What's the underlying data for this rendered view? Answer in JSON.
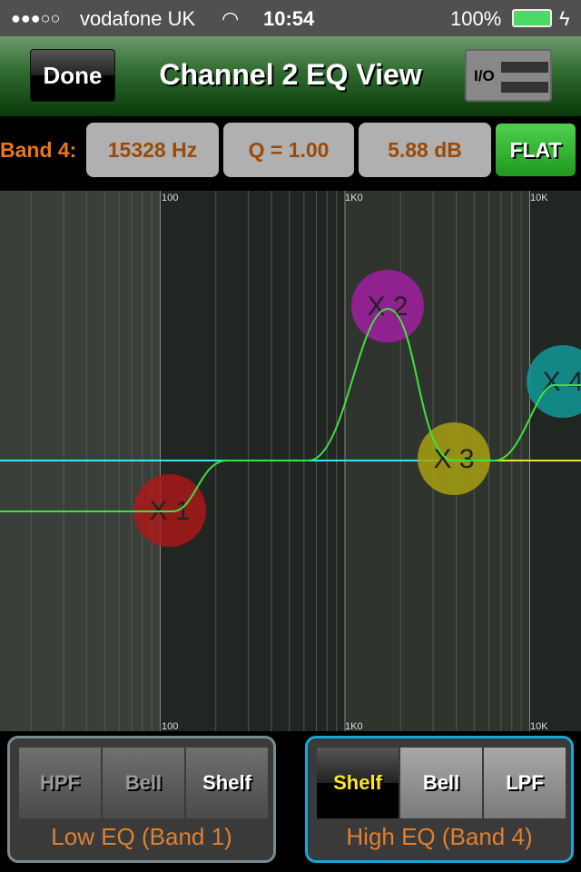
{
  "status_bar": {
    "signal": "●●●○○",
    "carrier": "vodafone UK",
    "time": "10:54",
    "battery": "100%"
  },
  "nav": {
    "done_label": "Done",
    "title": "Channel 2 EQ View",
    "io_label": "I/O"
  },
  "band_bar": {
    "label": "Band 4:",
    "frequency": "15328 Hz",
    "q": "Q = 1.00",
    "gain": "5.88 dB",
    "flat_label": "FLAT"
  },
  "graph": {
    "freq_labels": [
      "100",
      "1K0",
      "10K"
    ],
    "nodes": [
      {
        "label": "X 1",
        "color": "#b01818"
      },
      {
        "label": "X 2",
        "color": "#a020a0"
      },
      {
        "label": "X 3",
        "color": "#a8a010"
      },
      {
        "label": "X 4",
        "color": "#109898"
      }
    ],
    "curve_color": "#40e040",
    "flat_line_color": "#40e0f0"
  },
  "low_eq": {
    "title": "Low EQ (Band 1)",
    "buttons": [
      "HPF",
      "Bell",
      "Shelf"
    ],
    "selected": "Shelf"
  },
  "high_eq": {
    "title": "High EQ (Band 4)",
    "buttons": [
      "Shelf",
      "Bell",
      "LPF"
    ],
    "selected": "Shelf"
  }
}
